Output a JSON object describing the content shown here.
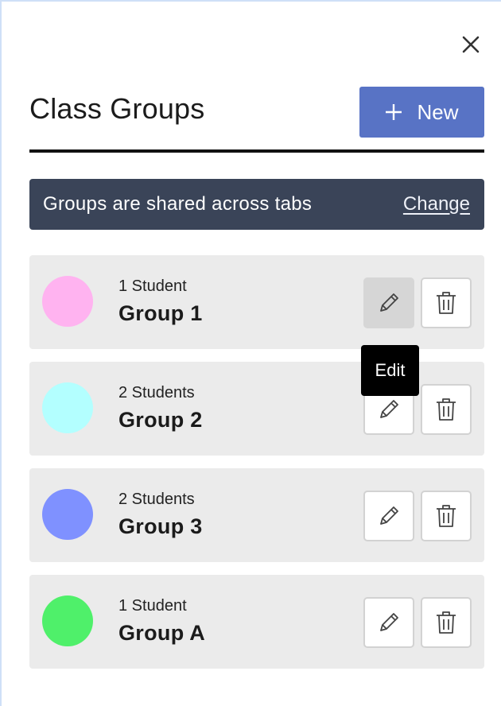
{
  "header": {
    "title": "Class Groups",
    "new_button_label": "New",
    "close_icon": "close-icon",
    "plus_icon": "plus-icon"
  },
  "banner": {
    "text": "Groups are shared across tabs",
    "link": "Change"
  },
  "groups": [
    {
      "count": "1 Student",
      "name": "Group 1",
      "color": "#ffb3f0"
    },
    {
      "count": "2 Students",
      "name": "Group 2",
      "color": "#b3ffff"
    },
    {
      "count": "2 Students",
      "name": "Group 3",
      "color": "#7f91ff"
    },
    {
      "count": "1 Student",
      "name": "Group A",
      "color": "#4ff06a"
    }
  ],
  "tooltip": {
    "text": "Edit"
  },
  "icons": {
    "edit": "pencil-icon",
    "delete": "trash-icon"
  },
  "colors": {
    "primary": "#5873c5",
    "banner_bg": "#3a4458",
    "row_bg": "#ebebeb"
  }
}
